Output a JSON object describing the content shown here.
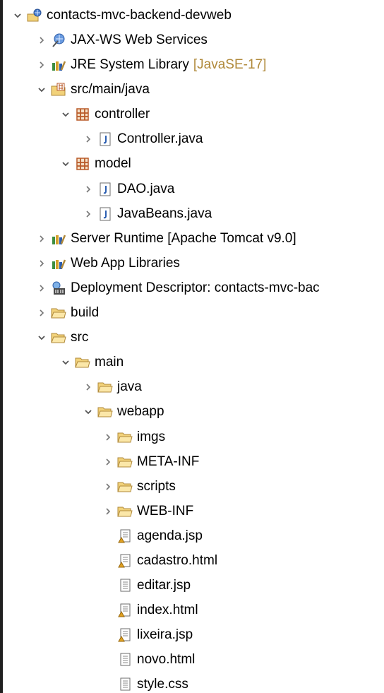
{
  "tree": {
    "project": "contacts-mvc-backend-devweb",
    "jaxws": "JAX-WS Web Services",
    "jre": {
      "label": "JRE System Library",
      "decoration": "[JavaSE-17]"
    },
    "src_main_java": "src/main/java",
    "pkg_controller": "controller",
    "controller_java": "Controller.java",
    "pkg_model": "model",
    "dao_java": "DAO.java",
    "javabeans_java": "JavaBeans.java",
    "server_runtime": "Server Runtime [Apache Tomcat v9.0]",
    "web_app_libraries": "Web App Libraries",
    "deployment_descriptor": "Deployment Descriptor: contacts-mvc-bac",
    "build": "build",
    "src": "src",
    "main": "main",
    "java": "java",
    "webapp": "webapp",
    "imgs": "imgs",
    "meta_inf": "META-INF",
    "scripts": "scripts",
    "web_inf": "WEB-INF",
    "agenda_jsp": "agenda.jsp",
    "cadastro_html": "cadastro.html",
    "editar_jsp": "editar.jsp",
    "index_html": "index.html",
    "lixeira_jsp": "lixeira.jsp",
    "novo_html": "novo.html",
    "style_css": "style.css"
  },
  "colors": {
    "folder": "#f2d27a",
    "package": "#b85a28",
    "java_file": "#2a5db0",
    "library": "#3e8e41",
    "twisty": "#6e6e6e"
  },
  "icons": {
    "project": "project-icon",
    "web_services": "web-services-icon",
    "library": "library-icon",
    "source_folder": "source-folder-icon",
    "package": "package-icon",
    "java_file": "java-file-icon",
    "deployment": "deployment-descriptor-icon",
    "folder": "folder-icon",
    "web_file": "web-file-icon",
    "text_file": "text-file-icon"
  }
}
